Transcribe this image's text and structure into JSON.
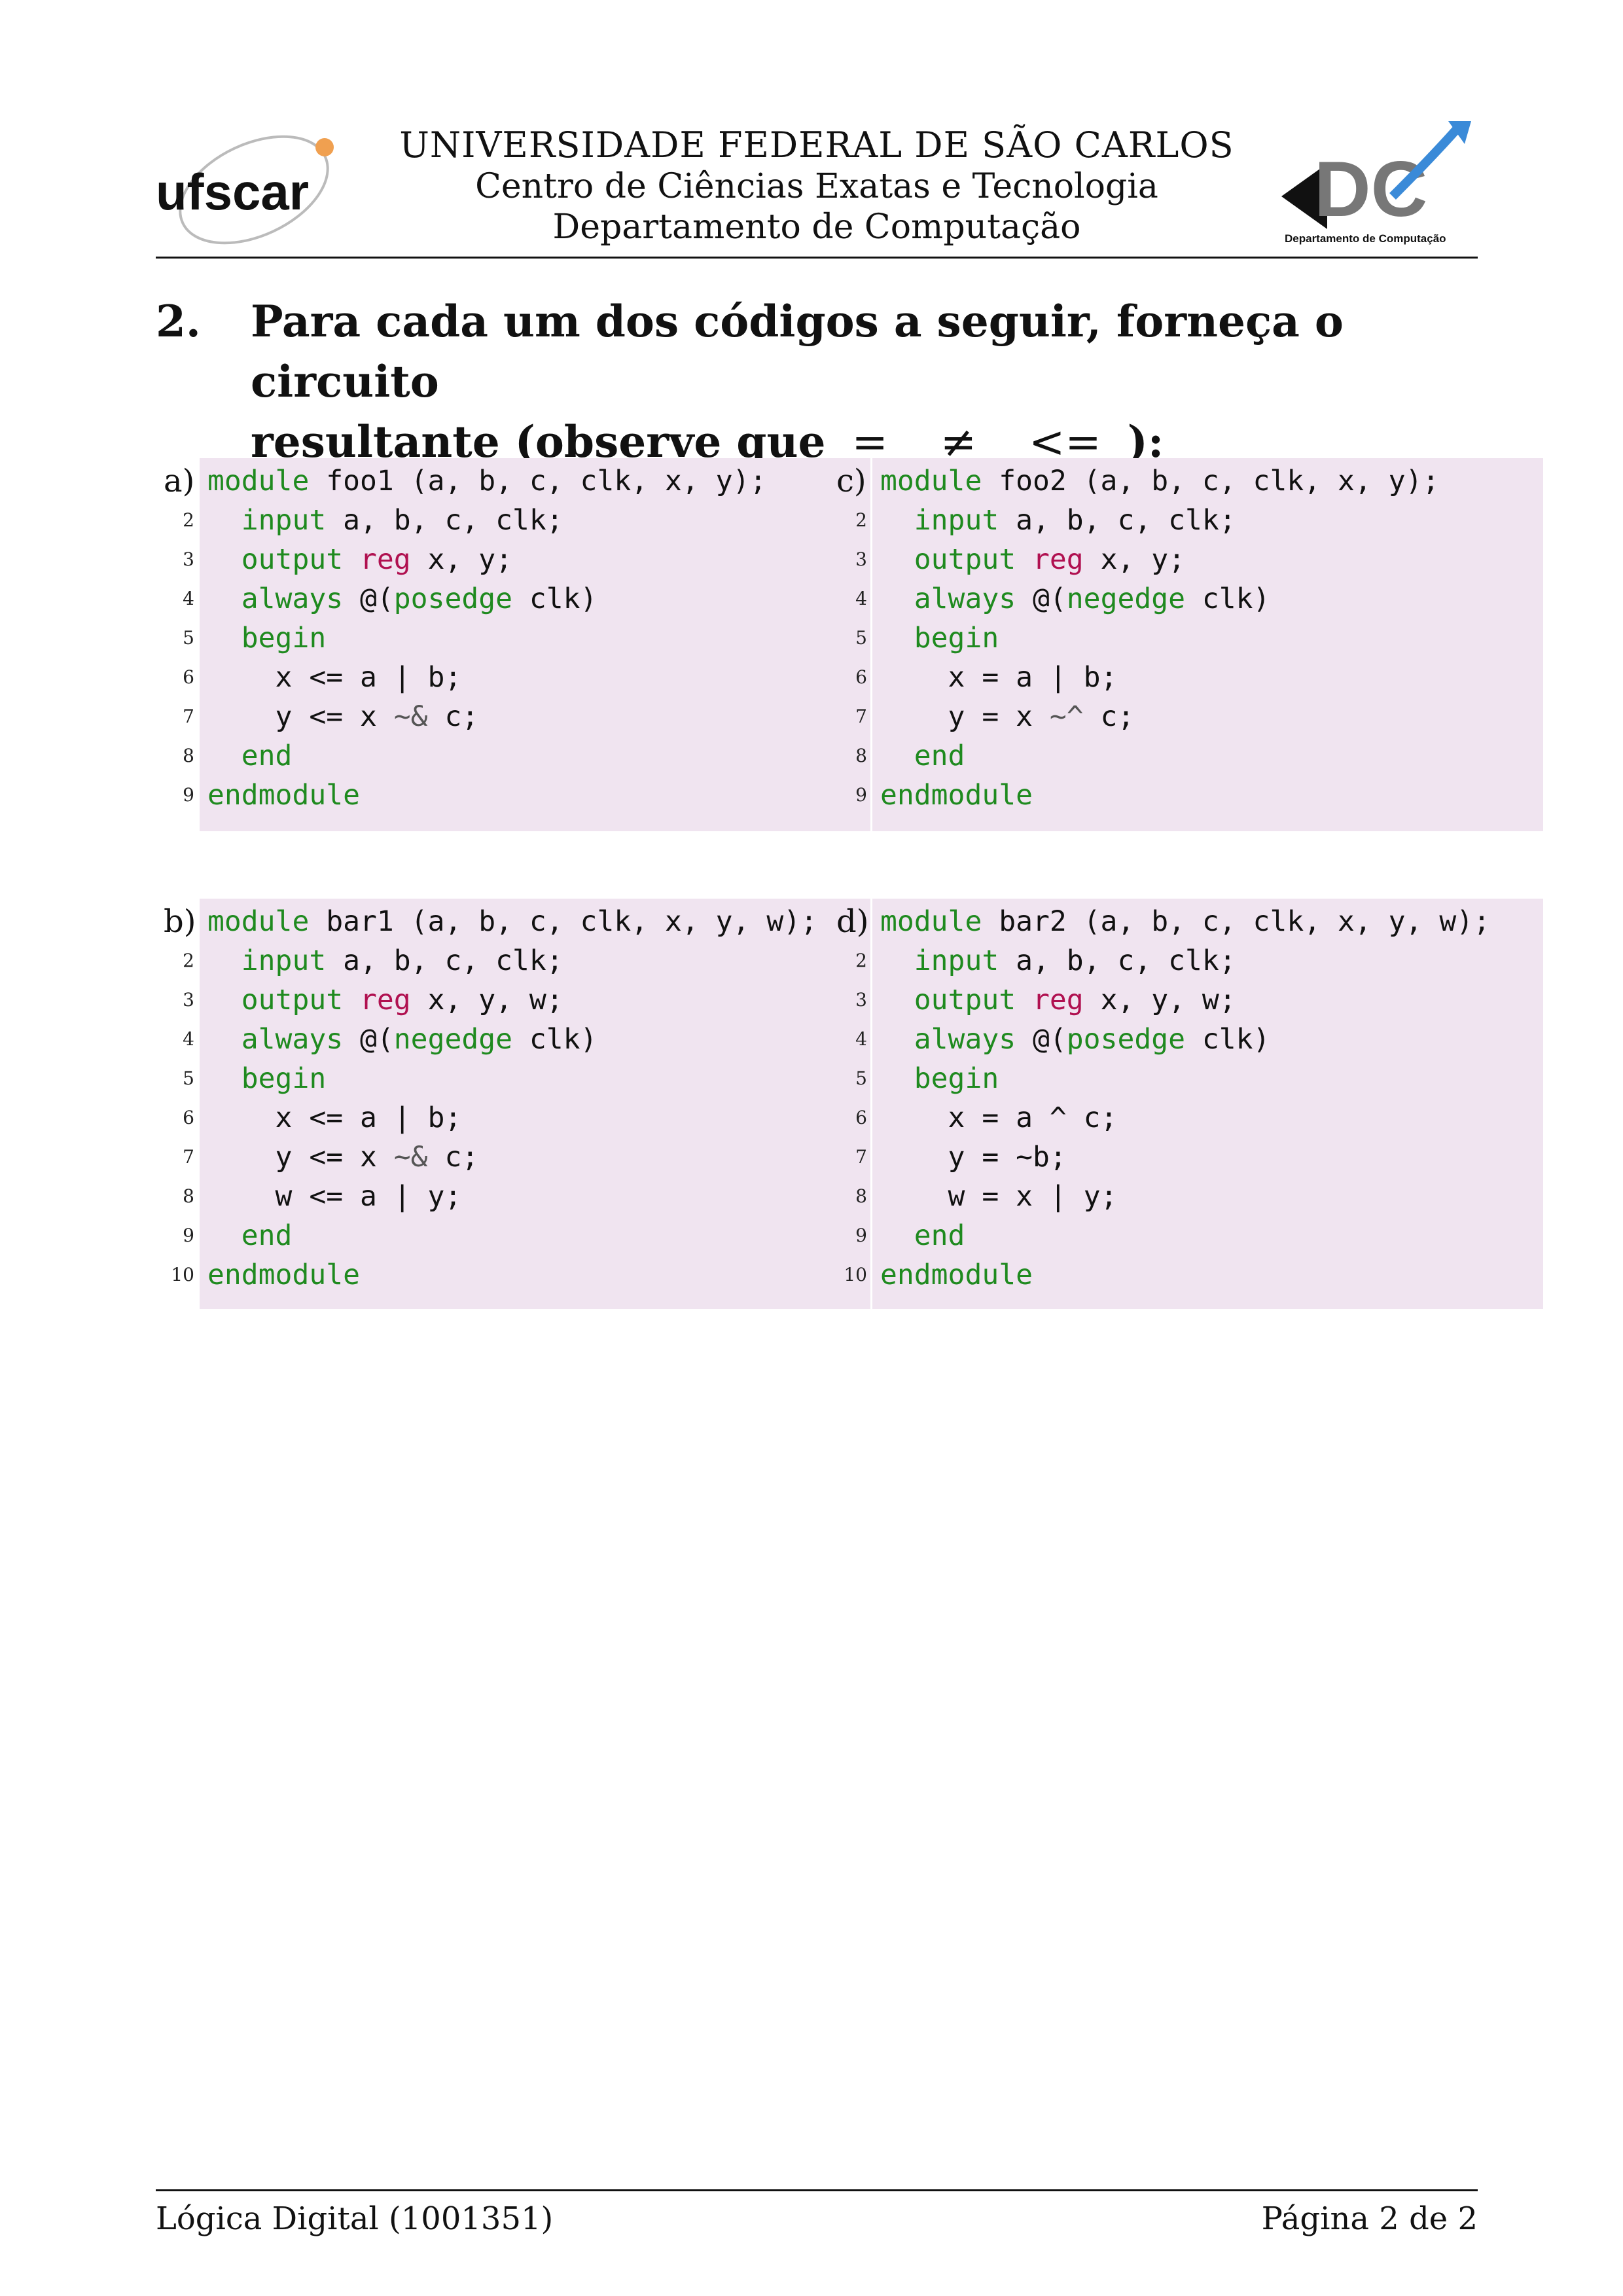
{
  "header": {
    "university": "UNIVERSIDADE FEDERAL DE SÃO CARLOS",
    "center": "Centro de Ciências Exatas e Tecnologia",
    "department": "Departamento de Computação",
    "logo_left_text": "ufscar",
    "logo_right_text": "DC",
    "logo_right_caption": "Departamento de Computação"
  },
  "question": {
    "number": "2.",
    "text_line1": "Para cada um dos códigos a seguir, forneça o circuito",
    "text_line2_start": "resultante (observe que",
    "sym_eq": "=",
    "sym_neq": "≠",
    "sym_le": "<=",
    "text_line2_end": "):"
  },
  "codes": {
    "a": {
      "label": "a)",
      "lines": [
        "module foo1 (a, b, c, clk, x, y);",
        "  input a, b, c, clk;",
        "  output reg x, y;",
        "  always @(posedge clk)",
        "  begin",
        "    x <= a | b;",
        "    y <= x ~& c;",
        "  end",
        "endmodule"
      ]
    },
    "c": {
      "label": "c)",
      "lines": [
        "module foo2 (a, b, c, clk, x, y);",
        "  input a, b, c, clk;",
        "  output reg x, y;",
        "  always @(negedge clk)",
        "  begin",
        "    x = a | b;",
        "    y = x ~^ c;",
        "  end",
        "endmodule"
      ]
    },
    "b": {
      "label": "b)",
      "lines": [
        "module bar1 (a, b, c, clk, x, y, w);",
        "  input a, b, c, clk;",
        "  output reg x, y, w;",
        "  always @(negedge clk)",
        "  begin",
        "    x <= a | b;",
        "    y <= x ~& c;",
        "    w <= a | y;",
        "  end",
        "endmodule"
      ]
    },
    "d": {
      "label": "d)",
      "lines": [
        "module bar2 (a, b, c, clk, x, y, w);",
        "  input a, b, c, clk;",
        "  output reg x, y, w;",
        "  always @(posedge clk)",
        "  begin",
        "    x = a ^ c;",
        "    y = ~b;",
        "    w = x | y;",
        "  end",
        "endmodule"
      ]
    }
  },
  "footer": {
    "course": "Lógica Digital (1001351)",
    "page": "Página 2 de 2"
  },
  "colors": {
    "keyword": "#1f8a1f",
    "reg": "#b01050",
    "code_background": "#f0e4f0"
  }
}
